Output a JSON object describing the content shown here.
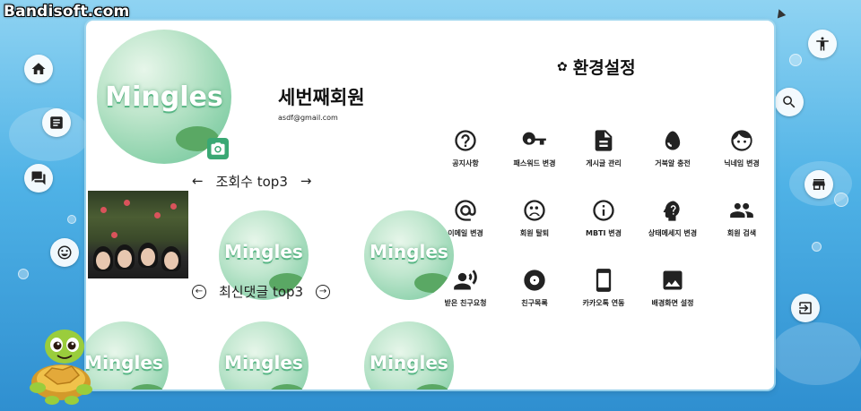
{
  "watermark": "Bandisoft.com",
  "side_nav": {
    "left": [
      {
        "name": "home-icon"
      },
      {
        "name": "board-icon"
      },
      {
        "name": "chat-icon"
      },
      {
        "name": "emoji-icon"
      }
    ],
    "right": [
      {
        "name": "accessibility-icon"
      },
      {
        "name": "search-icon"
      },
      {
        "name": "store-icon"
      },
      {
        "name": "logout-icon"
      }
    ]
  },
  "profile": {
    "nickname": "세번째회원",
    "email": "asdf@gmail.com",
    "avatar_logo_text": "Mingles"
  },
  "views_top3": {
    "title": "조회수 top3",
    "prev": "←",
    "next": "→",
    "items": [
      "",
      "Mingles",
      "Mingles"
    ]
  },
  "comments_top3": {
    "title": "최신댓글 top3",
    "prev": "←",
    "next": "→",
    "items": [
      "Mingles",
      "Mingles",
      "Mingles"
    ]
  },
  "settings": {
    "title": "환경설정",
    "items": [
      {
        "label": "공지사항",
        "icon": "help-circle-icon"
      },
      {
        "label": "패스워드 변경",
        "icon": "key-icon"
      },
      {
        "label": "게시글 관리",
        "icon": "document-icon"
      },
      {
        "label": "거북알 충전",
        "icon": "egg-icon"
      },
      {
        "label": "닉네임 변경",
        "icon": "face-icon"
      },
      {
        "label": "이메일 변경",
        "icon": "at-sign-icon"
      },
      {
        "label": "회원 탈퇴",
        "icon": "sad-face-icon"
      },
      {
        "label": "MBTI 변경",
        "icon": "info-icon"
      },
      {
        "label": "상태메세지 변경",
        "icon": "head-question-icon"
      },
      {
        "label": "회원 검색",
        "icon": "people-icon"
      },
      {
        "label": "받은 친구요청",
        "icon": "person-voice-icon"
      },
      {
        "label": "친구목록",
        "icon": "album-icon"
      },
      {
        "label": "카카오톡 연동",
        "icon": "smartphone-icon"
      },
      {
        "label": "배경화면 설정",
        "icon": "image-icon"
      }
    ]
  },
  "colors": {
    "accent_green": "#3aa874",
    "background_sky": "#4fb2e6"
  }
}
